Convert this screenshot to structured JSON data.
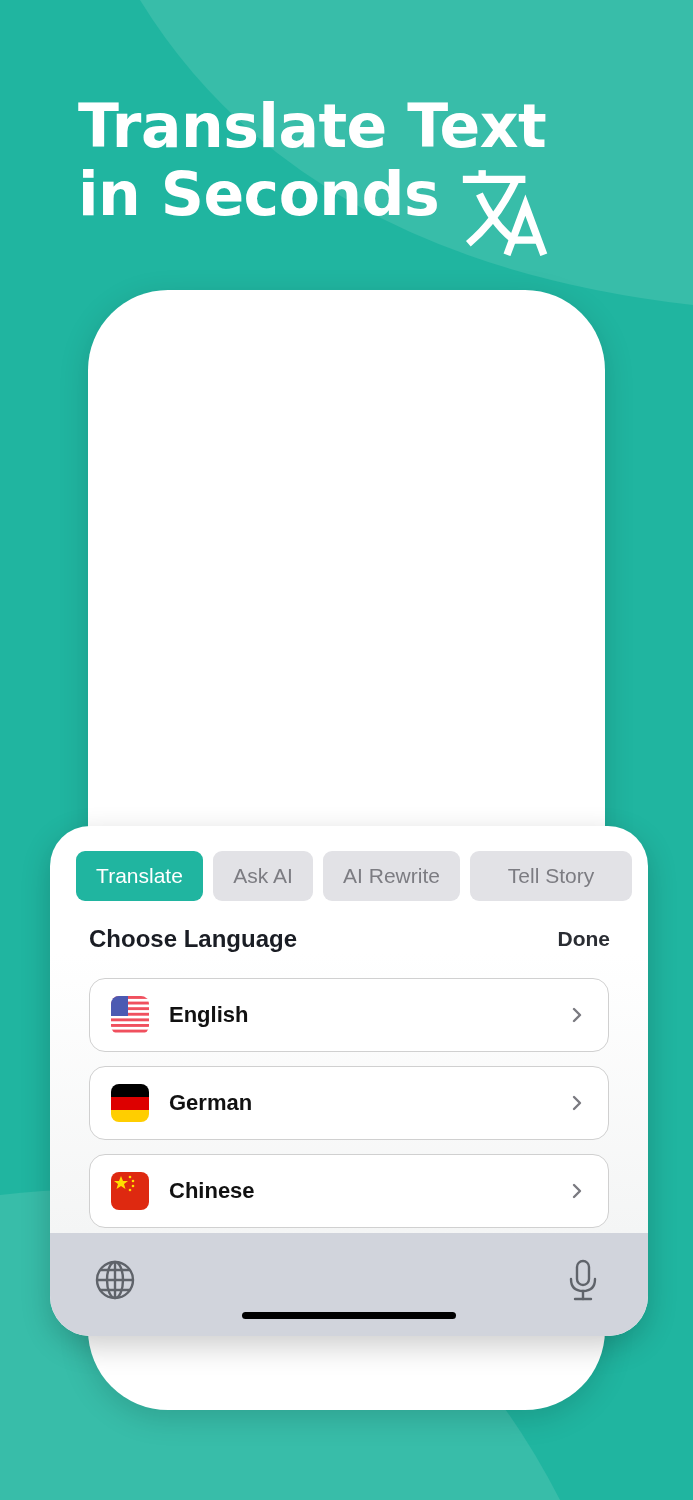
{
  "headline": [
    "Translate Text",
    "in Seconds"
  ],
  "tabs": [
    {
      "label": "Translate",
      "selected": true
    },
    {
      "label": "Ask AI",
      "selected": false
    },
    {
      "label": "AI Rewrite",
      "selected": false
    },
    {
      "label": "Tell Story",
      "selected": false
    }
  ],
  "sheet": {
    "title": "Choose Language",
    "done": "Done"
  },
  "languages": [
    {
      "name": "English"
    },
    {
      "name": "German"
    },
    {
      "name": "Chinese"
    }
  ]
}
